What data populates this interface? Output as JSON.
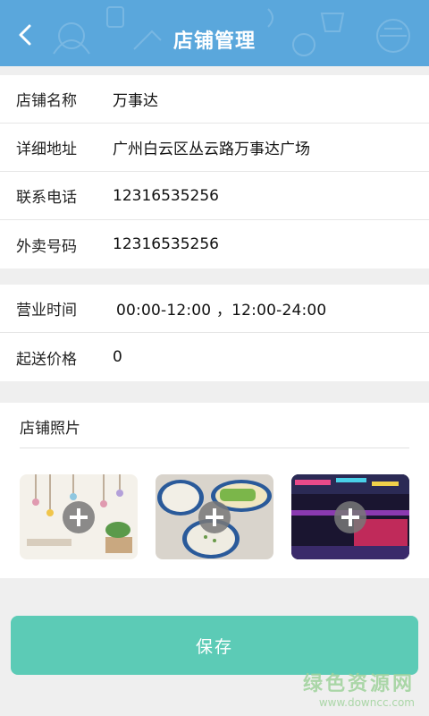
{
  "header": {
    "title": "店铺管理",
    "back_icon": "chevron-left-icon"
  },
  "shop_info": [
    {
      "label": "店铺名称",
      "value": "万事达"
    },
    {
      "label": "详细地址",
      "value": "广州白云区丛云路万事达广场"
    },
    {
      "label": "联系电话",
      "value": "12316535256"
    },
    {
      "label": "外卖号码",
      "value": "12316535256"
    }
  ],
  "business": [
    {
      "label": "营业时间",
      "value": "00:00-12:00 ，12:00-24:00"
    },
    {
      "label": "起送价格",
      "value": "0"
    }
  ],
  "photos": {
    "title": "店铺照片",
    "items": [
      {
        "subject": "cafe-interior"
      },
      {
        "subject": "congee-bowls"
      },
      {
        "subject": "night-street"
      }
    ]
  },
  "save_label": "保存",
  "watermark": {
    "main": "绿色资源网",
    "sub": "www.downcc.com"
  },
  "colors": {
    "header": "#5aa7dc",
    "save_button": "#5ccbb6",
    "background": "#efefef"
  }
}
